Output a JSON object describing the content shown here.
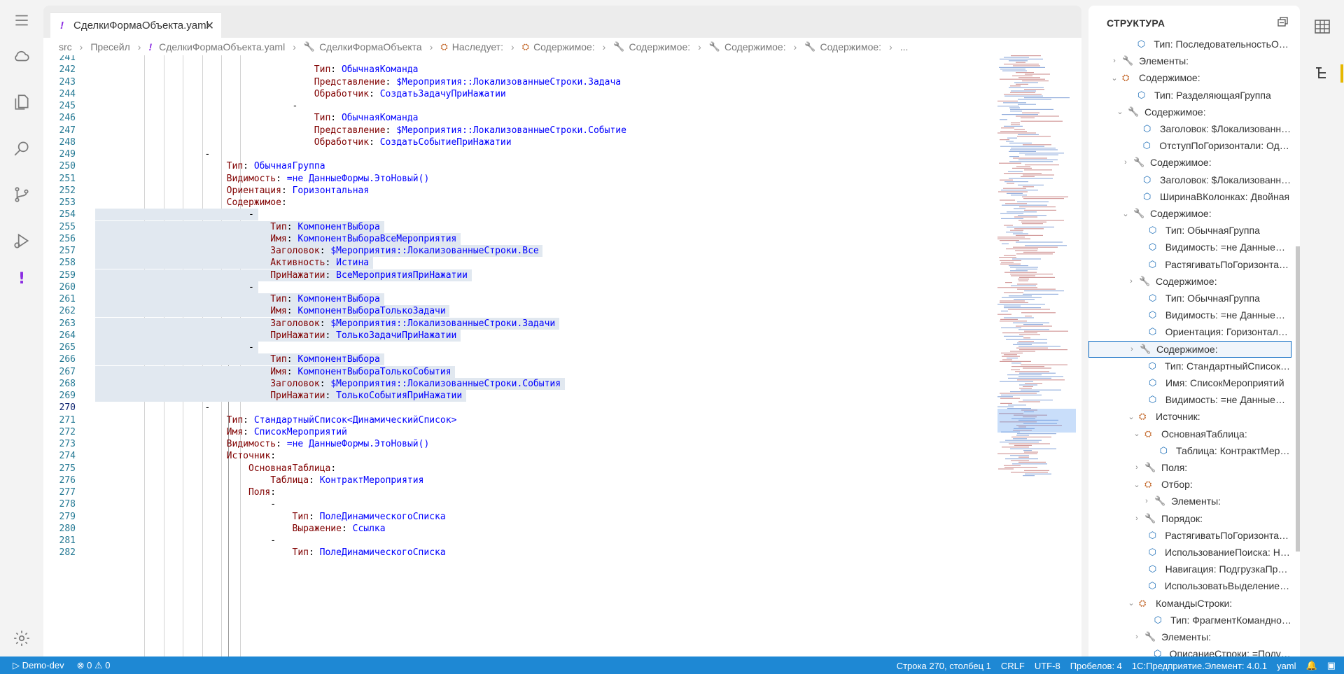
{
  "tab": {
    "title": "СделкиФормаОбъекта.yaml",
    "excl": "!",
    "close": "✕"
  },
  "breadcrumbs": [
    {
      "icon": "",
      "label": "src"
    },
    {
      "icon": "",
      "label": "Пресейл"
    },
    {
      "icon": "!",
      "label": "СделкиФормаОбъекта.yaml"
    },
    {
      "icon": "wrench",
      "label": "СделкиФормаОбъекта"
    },
    {
      "icon": "obj",
      "label": "Наследует:"
    },
    {
      "icon": "obj",
      "label": "Содержимое:"
    },
    {
      "icon": "wrench",
      "label": "Содержимое:"
    },
    {
      "icon": "wrench",
      "label": "Содержимое:"
    },
    {
      "icon": "wrench",
      "label": "Содержимое:"
    },
    {
      "icon": "",
      "label": "..."
    }
  ],
  "code": [
    {
      "n": "241",
      "d": "",
      "k": "",
      "v": ""
    },
    {
      "n": "242",
      "d": "",
      "k": "Тип",
      "v": "ОбычнаяКоманда"
    },
    {
      "n": "243",
      "d": "",
      "k": "Представление",
      "v": "$Мероприятия::ЛокализованныеСтроки.Задача"
    },
    {
      "n": "244",
      "d": "",
      "k": "Обработчик",
      "v": "СоздатьЗадачуПриНажатии"
    },
    {
      "n": "245",
      "d": "-",
      "k": "",
      "v": ""
    },
    {
      "n": "246",
      "d": "",
      "k": "Тип",
      "v": "ОбычнаяКоманда"
    },
    {
      "n": "247",
      "d": "",
      "k": "Представление",
      "v": "$Мероприятия::ЛокализованныеСтроки.Событие"
    },
    {
      "n": "248",
      "d": "",
      "k": "Обработчик",
      "v": "СоздатьСобытиеПриНажатии"
    },
    {
      "n": "249",
      "d": "-",
      "k": "",
      "v": ""
    },
    {
      "n": "250",
      "d": "",
      "k": "Тип",
      "v": "ОбычнаяГруппа"
    },
    {
      "n": "251",
      "d": "",
      "k": "Видимость",
      "v": "=не ДанныеФормы.ЭтоНовый()"
    },
    {
      "n": "252",
      "d": "",
      "k": "Ориентация",
      "v": "Горизонтальная"
    },
    {
      "n": "253",
      "d": "",
      "k": "Содержимое",
      "v": ""
    },
    {
      "n": "254",
      "d": "-",
      "k": "",
      "v": ""
    },
    {
      "n": "255",
      "d": "",
      "k": "Тип",
      "v": "КомпонентВыбора"
    },
    {
      "n": "256",
      "d": "",
      "k": "Имя",
      "v": "КомпонентВыбораВсеМероприятия"
    },
    {
      "n": "257",
      "d": "",
      "k": "Заголовок",
      "v": "$Мероприятия::ЛокализованныеСтроки.Все"
    },
    {
      "n": "258",
      "d": "",
      "k": "Активность",
      "v": "Истина"
    },
    {
      "n": "259",
      "d": "",
      "k": "ПриНажатии",
      "v": "ВсеМероприятияПриНажатии"
    },
    {
      "n": "260",
      "d": "-",
      "k": "",
      "v": ""
    },
    {
      "n": "261",
      "d": "",
      "k": "Тип",
      "v": "КомпонентВыбора"
    },
    {
      "n": "262",
      "d": "",
      "k": "Имя",
      "v": "КомпонентВыбораТолькоЗадачи"
    },
    {
      "n": "263",
      "d": "",
      "k": "Заголовок",
      "v": "$Мероприятия::ЛокализованныеСтроки.Задачи"
    },
    {
      "n": "264",
      "d": "",
      "k": "ПриНажатии",
      "v": "ТолькоЗадачиПриНажатии"
    },
    {
      "n": "265",
      "d": "-",
      "k": "",
      "v": ""
    },
    {
      "n": "266",
      "d": "",
      "k": "Тип",
      "v": "КомпонентВыбора"
    },
    {
      "n": "267",
      "d": "",
      "k": "Имя",
      "v": "КомпонентВыбораТолькоСобытия"
    },
    {
      "n": "268",
      "d": "",
      "k": "Заголовок",
      "v": "$Мероприятия::ЛокализованныеСтроки.События"
    },
    {
      "n": "269",
      "d": "",
      "k": "ПриНажатии",
      "v": "ТолькоСобытияПриНажатии"
    },
    {
      "n": "270",
      "d": "-",
      "k": "",
      "v": ""
    },
    {
      "n": "271",
      "d": "",
      "k": "Тип",
      "v": "СтандартныйСписок<ДинамическийСписок>"
    },
    {
      "n": "272",
      "d": "",
      "k": "Имя",
      "v": "СписокМероприятий"
    },
    {
      "n": "273",
      "d": "",
      "k": "Видимость",
      "v": "=не ДанныеФормы.ЭтоНовый()"
    },
    {
      "n": "274",
      "d": "",
      "k": "Источник",
      "v": ""
    },
    {
      "n": "275",
      "d": "",
      "k": "ОсновнаяТаблица",
      "v": ""
    },
    {
      "n": "276",
      "d": "",
      "k": "Таблица",
      "v": "КонтрактМероприятия"
    },
    {
      "n": "277",
      "d": "",
      "k": "Поля",
      "v": ""
    },
    {
      "n": "278",
      "d": "-",
      "k": "",
      "v": ""
    },
    {
      "n": "279",
      "d": "",
      "k": "Тип",
      "v": "ПолеДинамическогоСписка"
    },
    {
      "n": "280",
      "d": "",
      "k": "Выражение",
      "v": "Ссылка"
    },
    {
      "n": "281",
      "d": "-",
      "k": "",
      "v": ""
    },
    {
      "n": "282",
      "d": "",
      "k": "Тип",
      "v": "ПолеДинамическогоСписка"
    }
  ],
  "sidebar": {
    "title": "СТРУКТУРА",
    "items": [
      {
        "tw": "",
        "ic": "cube",
        "label": "Тип: ПоследовательностьОб…"
      },
      {
        "tw": ">",
        "ic": "wrench",
        "label": "Элементы:"
      },
      {
        "tw": "v",
        "ic": "obj",
        "label": "Содержимое:"
      },
      {
        "tw": "",
        "ic": "cube",
        "label": "Тип: РазделяющаяГруппа"
      },
      {
        "tw": "v",
        "ic": "wrench",
        "label": "Содержимое:"
      },
      {
        "tw": "",
        "ic": "cube",
        "label": "Заголовок: $Локализованн…"
      },
      {
        "tw": "",
        "ic": "cube",
        "label": "ОтступПоГоризонтали: Оди…"
      },
      {
        "tw": ">",
        "ic": "wrench",
        "label": "Содержимое:"
      },
      {
        "tw": "",
        "ic": "cube",
        "label": "Заголовок: $Локализованн…"
      },
      {
        "tw": "",
        "ic": "cube",
        "label": "ШиринаВКолонках: Двойная"
      },
      {
        "tw": "v",
        "ic": "wrench",
        "label": "Содержимое:"
      },
      {
        "tw": "",
        "ic": "cube",
        "label": "Тип: ОбычнаяГруппа"
      },
      {
        "tw": "",
        "ic": "cube",
        "label": "Видимость: =не ДанныеФ…"
      },
      {
        "tw": "",
        "ic": "cube",
        "label": "РастягиватьПоГоризонтал…"
      },
      {
        "tw": ">",
        "ic": "wrench",
        "label": "Содержимое:"
      },
      {
        "tw": "",
        "ic": "cube",
        "label": "Тип: ОбычнаяГруппа"
      },
      {
        "tw": "",
        "ic": "cube",
        "label": "Видимость: =не ДанныеФ…"
      },
      {
        "tw": "",
        "ic": "cube",
        "label": "Ориентация: Горизонталь…"
      },
      {
        "tw": ">",
        "ic": "wrench",
        "label": "Содержимое:"
      },
      {
        "tw": "",
        "ic": "cube",
        "label": "Тип: СтандартныйСписок<…"
      },
      {
        "tw": "",
        "ic": "cube",
        "label": "Имя: СписокМероприятий"
      },
      {
        "tw": "",
        "ic": "cube",
        "label": "Видимость: =не ДанныеФ…"
      },
      {
        "tw": "v",
        "ic": "obj",
        "label": "Источник:"
      },
      {
        "tw": "v",
        "ic": "obj",
        "label": "ОсновнаяТаблица:"
      },
      {
        "tw": "",
        "ic": "cube",
        "label": "Таблица: КонтрактМеро…"
      },
      {
        "tw": ">",
        "ic": "wrench",
        "label": "Поля:"
      },
      {
        "tw": "v",
        "ic": "obj",
        "label": "Отбор:"
      },
      {
        "tw": ">",
        "ic": "wrench",
        "label": "Элементы:"
      },
      {
        "tw": ">",
        "ic": "wrench",
        "label": "Порядок:"
      },
      {
        "tw": "",
        "ic": "cube",
        "label": "РастягиватьПоГоризонтал…"
      },
      {
        "tw": "",
        "ic": "cube",
        "label": "ИспользованиеПоиска: Не…"
      },
      {
        "tw": "",
        "ic": "cube",
        "label": "Навигация: ПодгрузкаПри…"
      },
      {
        "tw": "",
        "ic": "cube",
        "label": "ИспользоватьВыделениеС…"
      },
      {
        "tw": "v",
        "ic": "obj",
        "label": "КомандыСтроки:"
      },
      {
        "tw": "",
        "ic": "cube",
        "label": "Тип: ФрагментКомандног…"
      },
      {
        "tw": ">",
        "ic": "wrench",
        "label": "Элементы:"
      },
      {
        "tw": "",
        "ic": "cube",
        "label": "ОписаниеСтроки: =Получи…"
      }
    ]
  },
  "status": {
    "remote": "Demo-dev",
    "errors": "0",
    "warnings": "0",
    "position": "Строка 270, столбец 1",
    "eol": "CRLF",
    "encoding": "UTF-8",
    "indent": "Пробелов: 4",
    "lang_mode": "1С:Предприятие.Элемент: 4.0.1",
    "lang": "yaml"
  }
}
